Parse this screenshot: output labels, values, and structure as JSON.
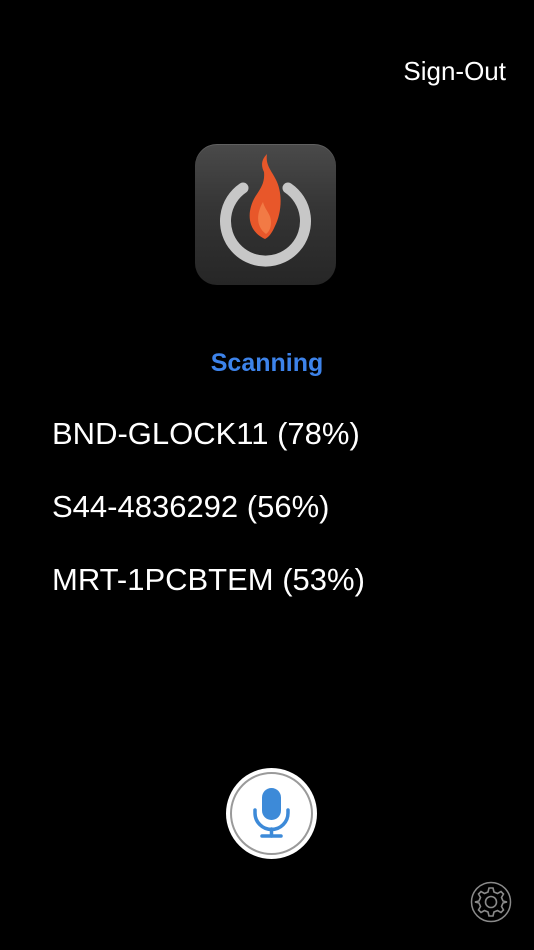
{
  "header": {
    "signout_label": "Sign-Out"
  },
  "logo": {
    "icon": "flame-power-icon"
  },
  "status": {
    "label": "Scanning"
  },
  "results": [
    {
      "label": "BND-GLOCK11 (78%)"
    },
    {
      "label": "S44-4836292 (56%)"
    },
    {
      "label": "MRT-1PCBTEM (53%)"
    }
  ],
  "controls": {
    "mic_icon": "microphone-icon",
    "settings_icon": "gear-icon"
  },
  "colors": {
    "background": "#000000",
    "accent": "#3d83ea",
    "text": "#ffffff",
    "flame": "#e8572a"
  }
}
